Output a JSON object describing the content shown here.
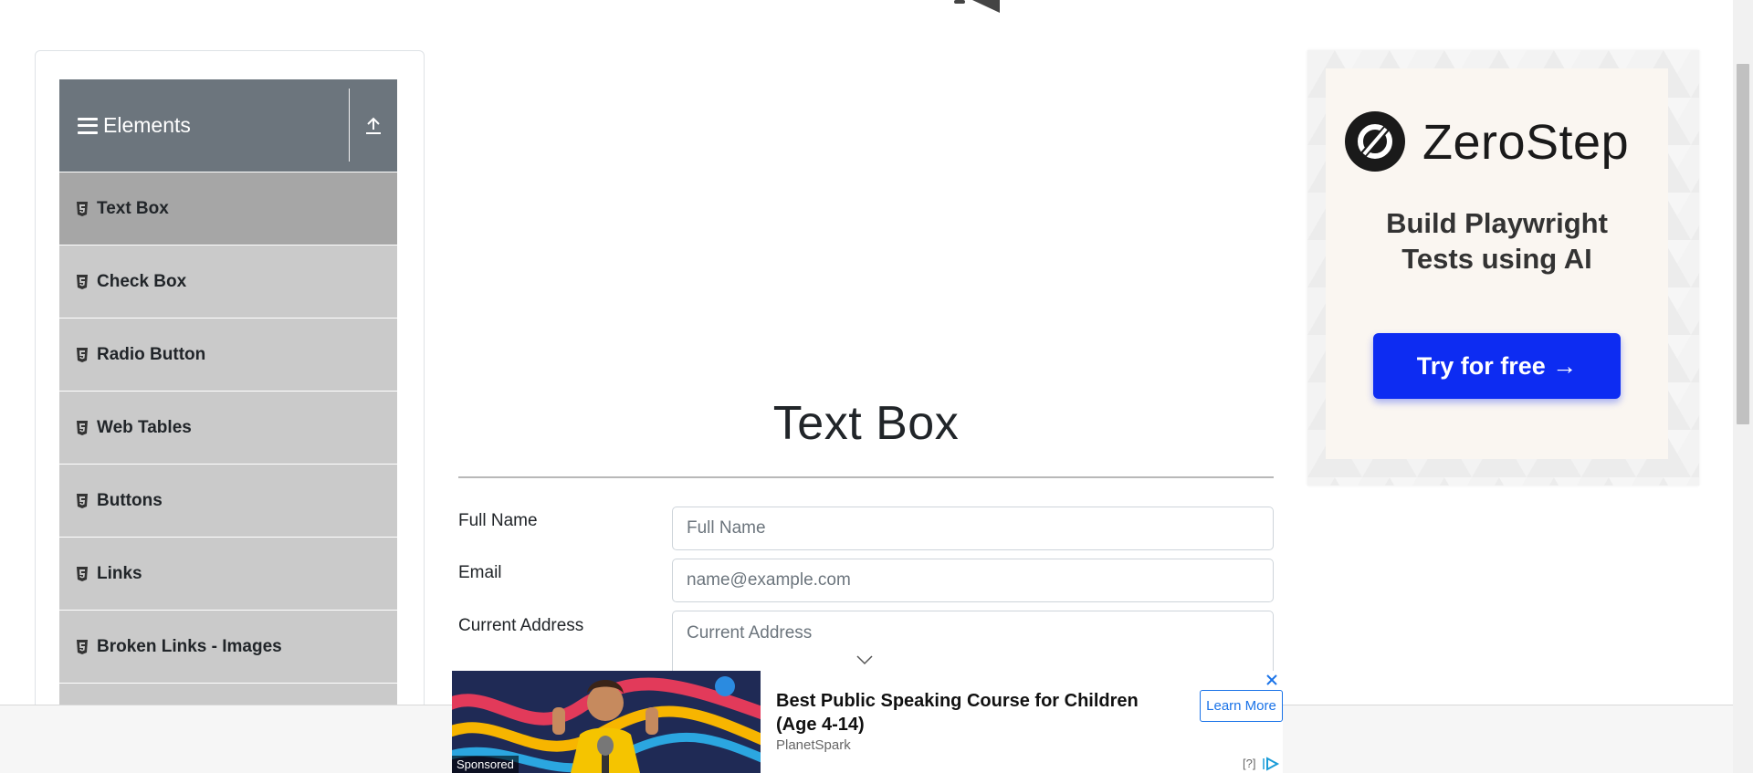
{
  "sidebar": {
    "group_title": "Elements",
    "items": [
      {
        "label": "Text Box",
        "active": true
      },
      {
        "label": "Check Box"
      },
      {
        "label": "Radio Button"
      },
      {
        "label": "Web Tables"
      },
      {
        "label": "Buttons"
      },
      {
        "label": "Links"
      },
      {
        "label": "Broken Links - Images"
      },
      {
        "label": ""
      }
    ]
  },
  "main": {
    "heading": "Text Box",
    "form": {
      "full_name": {
        "label": "Full Name",
        "placeholder": "Full Name",
        "value": ""
      },
      "email": {
        "label": "Email",
        "placeholder": "name@example.com",
        "value": ""
      },
      "current_address": {
        "label": "Current Address",
        "placeholder": "Current Address",
        "value": ""
      }
    }
  },
  "side_ad": {
    "brand": "ZeroStep",
    "tagline_line1": "Build Playwright",
    "tagline_line2": "Tests using AI",
    "cta": "Try for free →",
    "cta_color": "#0d2cf2"
  },
  "bottom_ad": {
    "sponsored": "Sponsored",
    "title": "Best Public Speaking Course for Children (Age 4-14)",
    "brand": "PlanetSpark",
    "cta": "Learn More",
    "info": "[?]"
  },
  "colors": {
    "sidebar_header": "#6c757d",
    "menu_item": "#cacaca",
    "menu_item_active": "#a6a6a6"
  }
}
